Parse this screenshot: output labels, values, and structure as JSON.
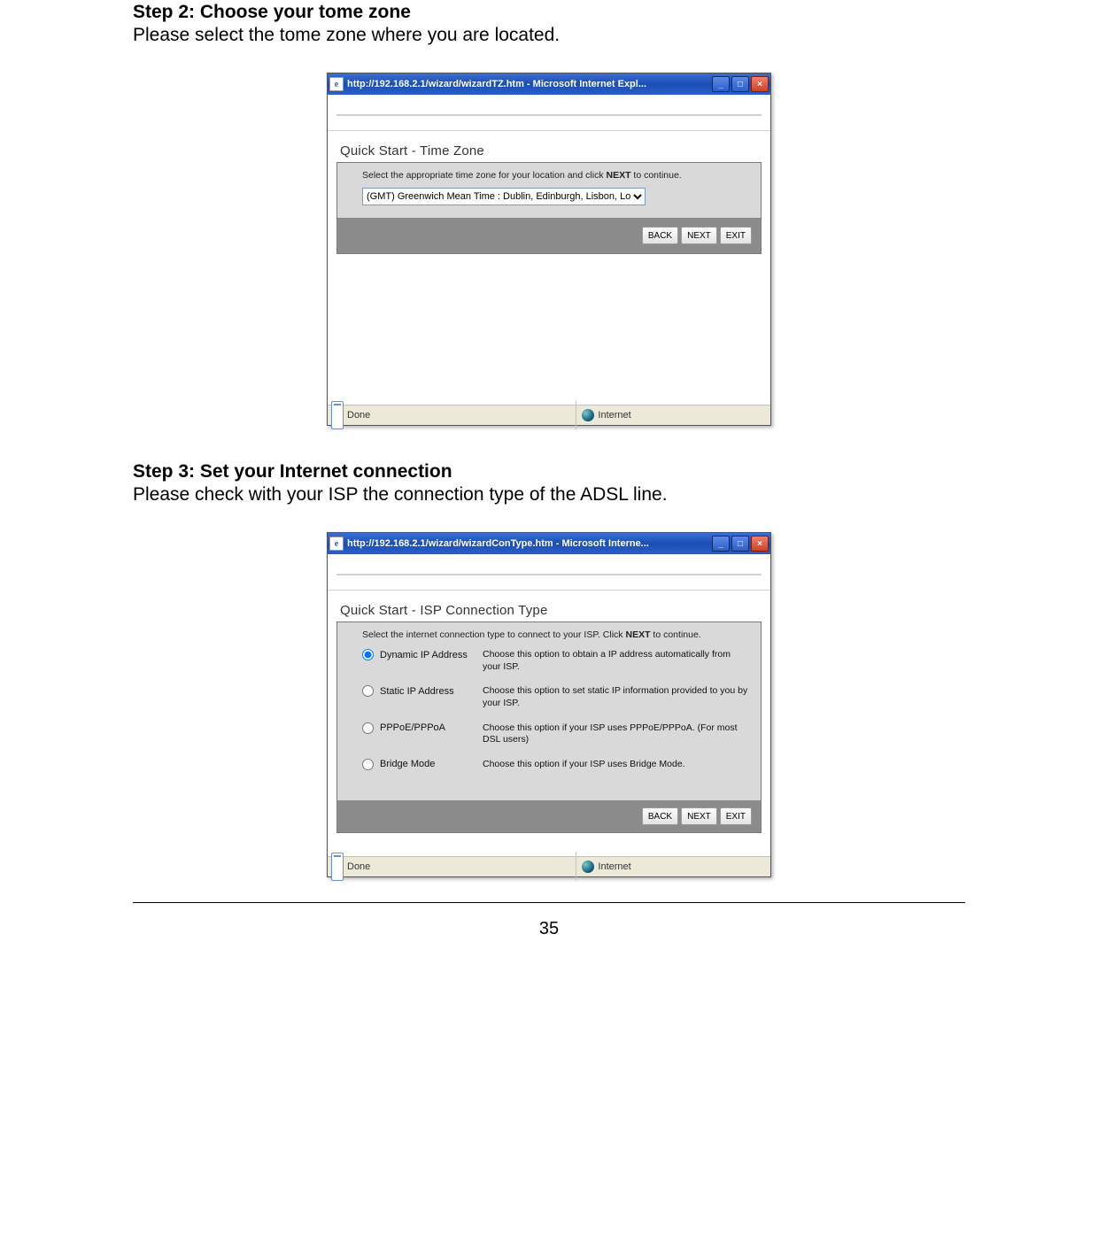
{
  "step2": {
    "title": "Step 2: Choose your tome zone",
    "text": "Please select the tome zone where you are located."
  },
  "step3": {
    "title": "Step 3: Set your Internet connection",
    "text": "Please check with your ISP the connection type of the ADSL line."
  },
  "win1": {
    "title": "http://192.168.2.1/wizard/wizardTZ.htm - Microsoft Internet Expl...",
    "panel_title": "Quick Start - Time Zone",
    "hint_a": "Select the appropriate time zone for your location and click ",
    "hint_b": "NEXT",
    "hint_c": " to continue.",
    "tz_value": "(GMT) Greenwich Mean Time : Dublin, Edinburgh, Lisbon, London",
    "back": "BACK",
    "next": "NEXT",
    "exit": "EXIT",
    "status_done": "Done",
    "status_net": "Internet"
  },
  "win2": {
    "title": "http://192.168.2.1/wizard/wizardConType.htm - Microsoft Interne...",
    "panel_title": "Quick Start - ISP Connection Type",
    "hint_a": "Select the internet connection type to connect to your ISP. Click ",
    "hint_b": "NEXT",
    "hint_c": " to continue.",
    "opts": [
      {
        "label": "Dynamic IP Address",
        "desc": "Choose this option to obtain a IP address automatically from your ISP."
      },
      {
        "label": "Static IP Address",
        "desc": "Choose this option to set static IP information provided to you by your ISP."
      },
      {
        "label": "PPPoE/PPPoA",
        "desc": "Choose this option if your ISP uses PPPoE/PPPoA. (For most DSL users)"
      },
      {
        "label": "Bridge Mode",
        "desc": "Choose this option if your ISP uses Bridge Mode."
      }
    ],
    "back": "BACK",
    "next": "NEXT",
    "exit": "EXIT",
    "status_done": "Done",
    "status_net": "Internet"
  },
  "page_number": "35"
}
